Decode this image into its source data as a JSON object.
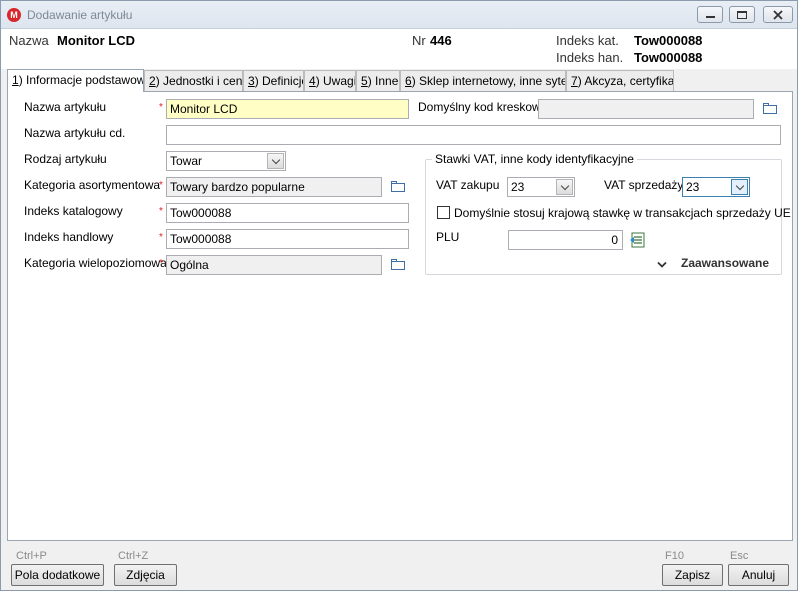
{
  "window": {
    "app_icon_letter": "M",
    "title": "Dodawanie artykułu"
  },
  "header": {
    "name_label": "Nazwa",
    "name_value": "Monitor LCD",
    "nr_label": "Nr",
    "nr_value": "446",
    "catalog_index_label": "Indeks kat.",
    "catalog_index_value": "Tow000088",
    "trade_index_label": "Indeks han.",
    "trade_index_value": "Tow000088"
  },
  "tabs": [
    {
      "key": "1",
      "label": ") Informacje podstawowe"
    },
    {
      "key": "2",
      "label": ") Jednostki i ceny"
    },
    {
      "key": "3",
      "label": ") Definicje"
    },
    {
      "key": "4",
      "label": ") Uwagi"
    },
    {
      "key": "5",
      "label": ") Inne"
    },
    {
      "key": "6",
      "label": ") Sklep internetowy, inne sytemy"
    },
    {
      "key": "7",
      "label": ") Akcyza, certyfikat"
    }
  ],
  "form": {
    "name_label": "Nazwa artykułu",
    "name_value": "Monitor LCD",
    "name_cont_label": "Nazwa artykułu cd.",
    "name_cont_value": "",
    "type_label": "Rodzaj artykułu",
    "type_value": "Towar",
    "category_label": "Kategoria asortymentowa",
    "category_value": "Towary bardzo popularne",
    "catalog_index_label": "Indeks katalogowy",
    "catalog_index_value": "Tow000088",
    "trade_index_label": "Indeks handlowy",
    "trade_index_value": "Tow000088",
    "multilevel_label": "Kategoria wielopoziomowa",
    "multilevel_value": "Ogólna",
    "barcode_label": "Domyślny kod kreskowy",
    "barcode_value": "",
    "required_mark": "*"
  },
  "vat": {
    "group_title": "Stawki VAT, inne kody identyfikacyjne",
    "purchase_label": "VAT zakupu",
    "purchase_value": "23",
    "sale_label": "VAT sprzedaży",
    "sale_value": "23",
    "checkbox_label": "Domyślnie stosuj krajową stawkę w transakcjach sprzedaży UE",
    "plu_label": "PLU",
    "plu_value": "0",
    "advanced_label": "Zaawansowane"
  },
  "footer": {
    "extra_hint": "Ctrl+P",
    "extra_label": "Pola dodatkowe",
    "photos_hint": "Ctrl+Z",
    "photos_label": "Zdjęcia",
    "save_hint": "F10",
    "save_label": "Zapisz",
    "cancel_hint": "Esc",
    "cancel_label": "Anuluj"
  }
}
